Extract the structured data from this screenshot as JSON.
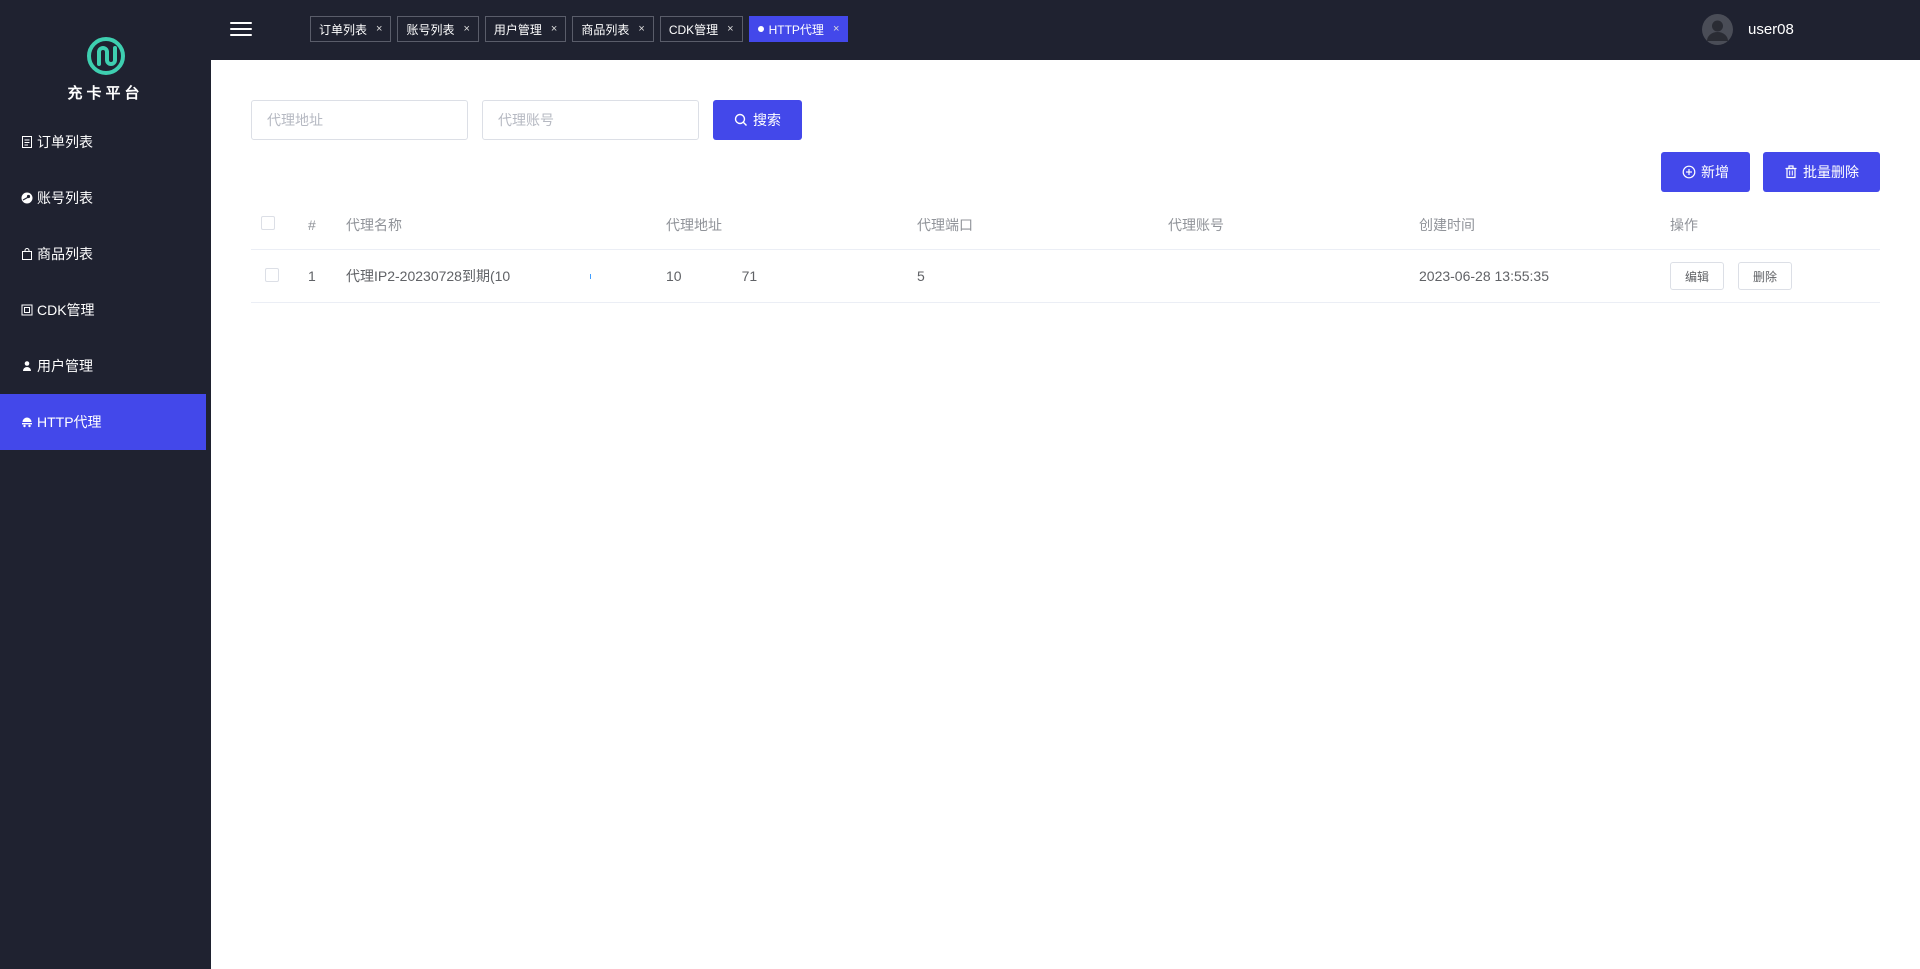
{
  "app": {
    "name": "充卡平台"
  },
  "sidebar": {
    "items": [
      {
        "label": "订单列表",
        "icon": "document-icon",
        "active": false
      },
      {
        "label": "账号列表",
        "icon": "steam-icon",
        "active": false
      },
      {
        "label": "商品列表",
        "icon": "shopping-bag-icon",
        "active": false
      },
      {
        "label": "CDK管理",
        "icon": "ticket-icon",
        "active": false
      },
      {
        "label": "用户管理",
        "icon": "user-icon",
        "active": false
      },
      {
        "label": "HTTP代理",
        "icon": "proxy-icon",
        "active": true
      }
    ]
  },
  "header": {
    "tabs": [
      {
        "label": "订单列表",
        "active": false
      },
      {
        "label": "账号列表",
        "active": false
      },
      {
        "label": "用户管理",
        "active": false
      },
      {
        "label": "商品列表",
        "active": false
      },
      {
        "label": "CDK管理",
        "active": false
      },
      {
        "label": "HTTP代理",
        "active": true
      }
    ],
    "close_glyph": "×",
    "username": "user08"
  },
  "search": {
    "address_placeholder": "代理地址",
    "account_placeholder": "代理账号",
    "search_label": "搜索"
  },
  "toolbar": {
    "add_label": "新增",
    "batch_delete_label": "批量删除"
  },
  "table": {
    "columns": [
      "#",
      "代理名称",
      "代理地址",
      "代理端口",
      "代理账号",
      "创建时间",
      "操作"
    ],
    "rows": [
      {
        "index": "1",
        "name": "代理IP2-20230728到期(10",
        "address_a": "10",
        "address_b": "71",
        "port": "5",
        "account": "",
        "created": "2023-06-28 13:55:35",
        "edit_label": "编辑",
        "delete_label": "删除"
      }
    ]
  },
  "colors": {
    "sidebar_bg": "#1f2230",
    "accent": "#4348ea",
    "logo": "#3ecfb0"
  }
}
